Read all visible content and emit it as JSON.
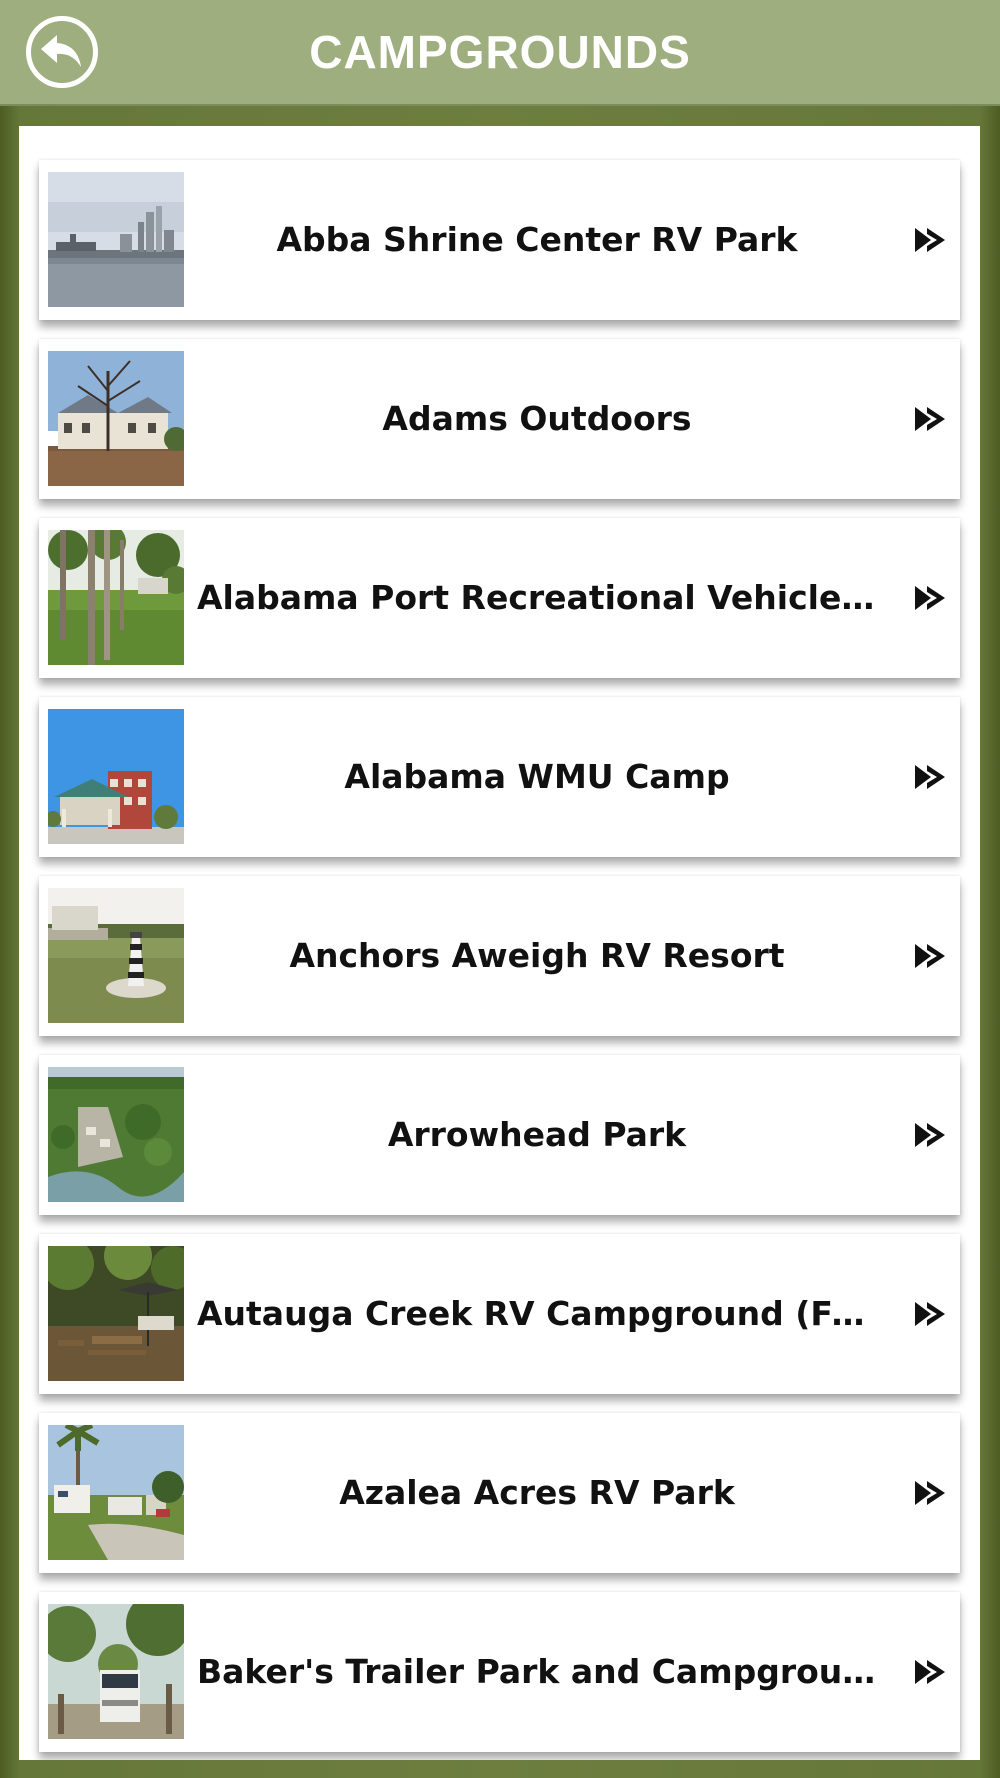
{
  "header": {
    "title": "CAMPGROUNDS",
    "back_icon": "back-arrow-icon"
  },
  "colors": {
    "header_bg": "#9fae7f",
    "frame_bg": "#6d7e3f",
    "text": "#111111"
  },
  "campgrounds": [
    {
      "name": "Abba Shrine Center RV Park",
      "thumb_icon": "city-waterfront-photo"
    },
    {
      "name": "Adams Outdoors",
      "thumb_icon": "historic-house-photo"
    },
    {
      "name": "Alabama Port Recreational Vehicle Park",
      "thumb_icon": "pine-trees-lawn-photo"
    },
    {
      "name": "Alabama WMU Camp",
      "thumb_icon": "lodge-building-photo"
    },
    {
      "name": "Anchors Aweigh RV Resort",
      "thumb_icon": "lighthouse-lawn-photo"
    },
    {
      "name": "Arrowhead Park",
      "thumb_icon": "aerial-park-photo"
    },
    {
      "name": "Autauga Creek RV Campground (Former…",
      "thumb_icon": "picnic-area-photo"
    },
    {
      "name": "Azalea Acres RV Park",
      "thumb_icon": "rv-palms-photo"
    },
    {
      "name": "Baker's Trailer Park and Campground",
      "thumb_icon": "rv-oak-trees-photo"
    }
  ],
  "row_arrow_icon": "double-chevron-right-icon"
}
